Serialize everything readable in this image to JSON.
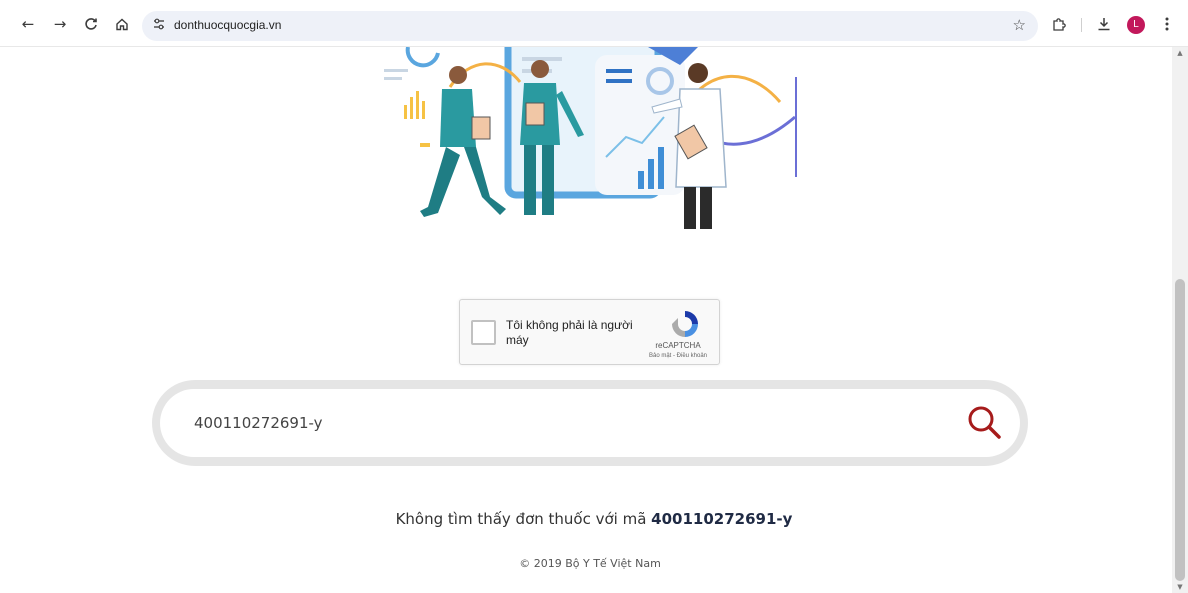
{
  "browser": {
    "url": "donthuocquocgia.vn",
    "avatar_initial": "L",
    "icons": {
      "back": "back-arrow-icon",
      "forward": "forward-arrow-icon",
      "reload": "reload-icon",
      "home": "home-icon",
      "site_info": "tune-icon",
      "bookmark": "star-icon",
      "extensions": "puzzle-icon",
      "downloads": "download-icon",
      "menu": "kebab-menu-icon"
    }
  },
  "captcha": {
    "label": "Tôi không phải là người máy",
    "brand": "reCAPTCHA",
    "terms": "Bảo mật - Điều khoản"
  },
  "search": {
    "value": "400110272691-y",
    "icon": "search-icon",
    "accent_color": "#a61b1b"
  },
  "result": {
    "prefix": "Không tìm thấy đơn thuốc với mã ",
    "code": "400110272691-y"
  },
  "footer": {
    "copyright": "© 2019 Bộ Y Tế Việt Nam"
  }
}
